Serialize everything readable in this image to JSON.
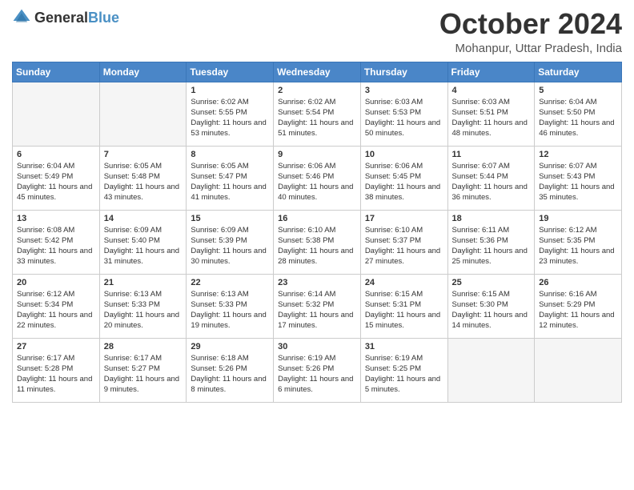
{
  "header": {
    "logo": {
      "general": "General",
      "blue": "Blue"
    },
    "title": "October 2024",
    "location": "Mohanpur, Uttar Pradesh, India"
  },
  "calendar": {
    "weekdays": [
      "Sunday",
      "Monday",
      "Tuesday",
      "Wednesday",
      "Thursday",
      "Friday",
      "Saturday"
    ],
    "weeks": [
      [
        {
          "day": "",
          "empty": true
        },
        {
          "day": "",
          "empty": true
        },
        {
          "day": "1",
          "sunrise": "6:02 AM",
          "sunset": "5:55 PM",
          "daylight": "11 hours and 53 minutes."
        },
        {
          "day": "2",
          "sunrise": "6:02 AM",
          "sunset": "5:54 PM",
          "daylight": "11 hours and 51 minutes."
        },
        {
          "day": "3",
          "sunrise": "6:03 AM",
          "sunset": "5:53 PM",
          "daylight": "11 hours and 50 minutes."
        },
        {
          "day": "4",
          "sunrise": "6:03 AM",
          "sunset": "5:51 PM",
          "daylight": "11 hours and 48 minutes."
        },
        {
          "day": "5",
          "sunrise": "6:04 AM",
          "sunset": "5:50 PM",
          "daylight": "11 hours and 46 minutes."
        }
      ],
      [
        {
          "day": "6",
          "sunrise": "6:04 AM",
          "sunset": "5:49 PM",
          "daylight": "11 hours and 45 minutes."
        },
        {
          "day": "7",
          "sunrise": "6:05 AM",
          "sunset": "5:48 PM",
          "daylight": "11 hours and 43 minutes."
        },
        {
          "day": "8",
          "sunrise": "6:05 AM",
          "sunset": "5:47 PM",
          "daylight": "11 hours and 41 minutes."
        },
        {
          "day": "9",
          "sunrise": "6:06 AM",
          "sunset": "5:46 PM",
          "daylight": "11 hours and 40 minutes."
        },
        {
          "day": "10",
          "sunrise": "6:06 AM",
          "sunset": "5:45 PM",
          "daylight": "11 hours and 38 minutes."
        },
        {
          "day": "11",
          "sunrise": "6:07 AM",
          "sunset": "5:44 PM",
          "daylight": "11 hours and 36 minutes."
        },
        {
          "day": "12",
          "sunrise": "6:07 AM",
          "sunset": "5:43 PM",
          "daylight": "11 hours and 35 minutes."
        }
      ],
      [
        {
          "day": "13",
          "sunrise": "6:08 AM",
          "sunset": "5:42 PM",
          "daylight": "11 hours and 33 minutes."
        },
        {
          "day": "14",
          "sunrise": "6:09 AM",
          "sunset": "5:40 PM",
          "daylight": "11 hours and 31 minutes."
        },
        {
          "day": "15",
          "sunrise": "6:09 AM",
          "sunset": "5:39 PM",
          "daylight": "11 hours and 30 minutes."
        },
        {
          "day": "16",
          "sunrise": "6:10 AM",
          "sunset": "5:38 PM",
          "daylight": "11 hours and 28 minutes."
        },
        {
          "day": "17",
          "sunrise": "6:10 AM",
          "sunset": "5:37 PM",
          "daylight": "11 hours and 27 minutes."
        },
        {
          "day": "18",
          "sunrise": "6:11 AM",
          "sunset": "5:36 PM",
          "daylight": "11 hours and 25 minutes."
        },
        {
          "day": "19",
          "sunrise": "6:12 AM",
          "sunset": "5:35 PM",
          "daylight": "11 hours and 23 minutes."
        }
      ],
      [
        {
          "day": "20",
          "sunrise": "6:12 AM",
          "sunset": "5:34 PM",
          "daylight": "11 hours and 22 minutes."
        },
        {
          "day": "21",
          "sunrise": "6:13 AM",
          "sunset": "5:33 PM",
          "daylight": "11 hours and 20 minutes."
        },
        {
          "day": "22",
          "sunrise": "6:13 AM",
          "sunset": "5:33 PM",
          "daylight": "11 hours and 19 minutes."
        },
        {
          "day": "23",
          "sunrise": "6:14 AM",
          "sunset": "5:32 PM",
          "daylight": "11 hours and 17 minutes."
        },
        {
          "day": "24",
          "sunrise": "6:15 AM",
          "sunset": "5:31 PM",
          "daylight": "11 hours and 15 minutes."
        },
        {
          "day": "25",
          "sunrise": "6:15 AM",
          "sunset": "5:30 PM",
          "daylight": "11 hours and 14 minutes."
        },
        {
          "day": "26",
          "sunrise": "6:16 AM",
          "sunset": "5:29 PM",
          "daylight": "11 hours and 12 minutes."
        }
      ],
      [
        {
          "day": "27",
          "sunrise": "6:17 AM",
          "sunset": "5:28 PM",
          "daylight": "11 hours and 11 minutes."
        },
        {
          "day": "28",
          "sunrise": "6:17 AM",
          "sunset": "5:27 PM",
          "daylight": "11 hours and 9 minutes."
        },
        {
          "day": "29",
          "sunrise": "6:18 AM",
          "sunset": "5:26 PM",
          "daylight": "11 hours and 8 minutes."
        },
        {
          "day": "30",
          "sunrise": "6:19 AM",
          "sunset": "5:26 PM",
          "daylight": "11 hours and 6 minutes."
        },
        {
          "day": "31",
          "sunrise": "6:19 AM",
          "sunset": "5:25 PM",
          "daylight": "11 hours and 5 minutes."
        },
        {
          "day": "",
          "empty": true
        },
        {
          "day": "",
          "empty": true
        }
      ]
    ],
    "labels": {
      "sunrise": "Sunrise:",
      "sunset": "Sunset:",
      "daylight": "Daylight:"
    }
  }
}
